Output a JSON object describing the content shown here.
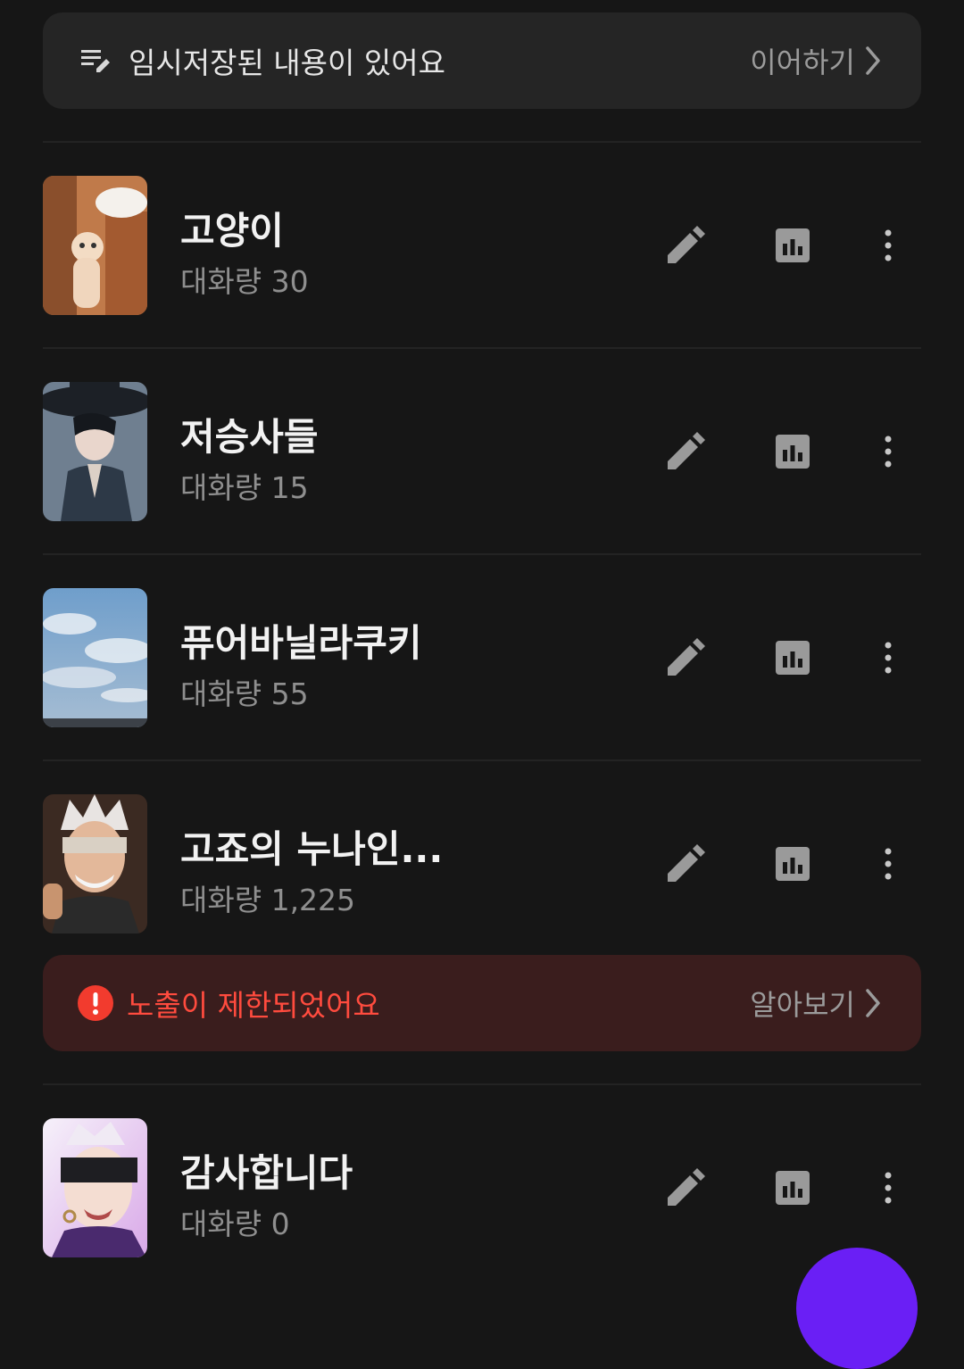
{
  "draft_banner": {
    "text": "임시저장된 내용이 있어요",
    "action": "이어하기"
  },
  "works": [
    {
      "title": "고양이",
      "count_label": "대화량 30",
      "thumb": "cat-comic-image"
    },
    {
      "title": "저승사들",
      "count_label": "대화량 15",
      "thumb": "dark-haired-man-hat-image"
    },
    {
      "title": "퓨어바닐라쿠키",
      "count_label": "대화량 55",
      "thumb": "cloudy-sky-image"
    },
    {
      "title": "고죠의 누나인...",
      "count_label": "대화량 1,225",
      "thumb": "anime-blindfold-character-image"
    },
    {
      "title": "감사합니다",
      "count_label": "대화량 0",
      "thumb": "anime-purple-blindfold-image"
    }
  ],
  "restriction_banner": {
    "text": "노출이 제한되었어요",
    "action": "알아보기"
  },
  "colors": {
    "background": "#161616",
    "banner": "#252525",
    "warning_bg": "#3a1d1d",
    "warning_text": "#ff4b3e",
    "fab": "#6a1ff5"
  }
}
